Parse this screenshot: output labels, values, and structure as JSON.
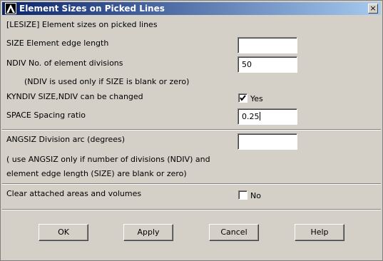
{
  "window": {
    "title": "Element Sizes on Picked Lines",
    "close_label": "×"
  },
  "header": {
    "text": "[LESIZE]  Element sizes on picked lines"
  },
  "size": {
    "label": "SIZE    Element edge length",
    "value": ""
  },
  "ndiv": {
    "label": "NDIV    No. of element divisions",
    "value": "50",
    "note": "(NDIV is used only if SIZE is blank or zero)"
  },
  "kyndiv": {
    "label": "KYNDIV  SIZE,NDIV can be changed",
    "checked": true,
    "option_label": "Yes"
  },
  "space": {
    "label": "SPACE   Spacing ratio",
    "value": "0.25"
  },
  "angsiz": {
    "label": "ANGSIZ  Division arc (degrees)",
    "value": "",
    "note_line1": "( use ANGSIZ only if number of divisions (NDIV) and",
    "note_line2": "element edge length (SIZE) are blank or zero)"
  },
  "clear": {
    "label": "Clear attached areas and volumes",
    "checked": false,
    "option_label": "No"
  },
  "buttons": {
    "ok": "OK",
    "apply": "Apply",
    "cancel": "Cancel",
    "help": "Help"
  },
  "icons": {
    "app": "ansys-logo-icon",
    "close": "close-icon",
    "check": "checkmark-icon"
  }
}
